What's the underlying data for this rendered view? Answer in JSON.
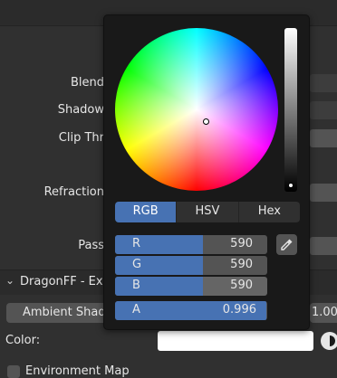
{
  "properties": {
    "blend_label": "Blend",
    "shadow_label": "Shadow",
    "clip_label": "Clip Thr",
    "refraction_label": "Refraction",
    "pass_label": "Pass"
  },
  "section": {
    "title": "DragonFF - Exp"
  },
  "ambient": {
    "label": "Ambient Shad",
    "value": "1.00"
  },
  "color_row": {
    "label": "Color:",
    "swatch_color": "#ffffff"
  },
  "env": {
    "label": "Environment Map"
  },
  "picker": {
    "modes": [
      "RGB",
      "HSV",
      "Hex"
    ],
    "active_mode": "RGB",
    "value_level": 1.0,
    "channels": [
      {
        "label": "R",
        "value": "590",
        "fill": 0.58
      },
      {
        "label": "G",
        "value": "590",
        "fill": 0.58
      },
      {
        "label": "B",
        "value": "590",
        "fill": 0.58
      }
    ],
    "alpha": {
      "label": "A",
      "value": "0.996",
      "fill": 0.996
    },
    "accent_color": "#4772b3"
  }
}
